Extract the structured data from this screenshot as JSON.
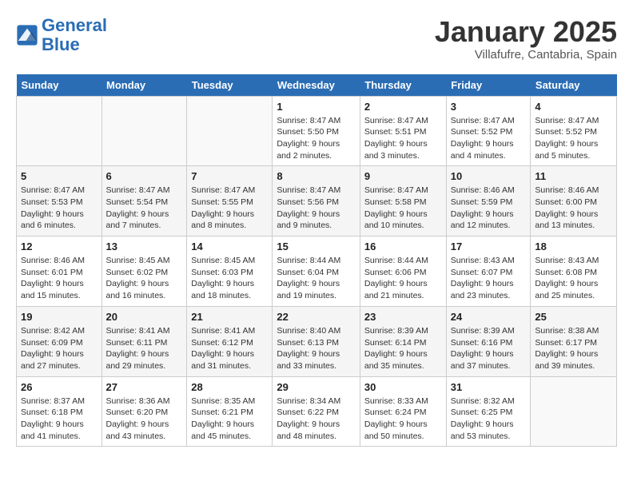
{
  "logo": {
    "line1": "General",
    "line2": "Blue"
  },
  "title": "January 2025",
  "location": "Villafufre, Cantabria, Spain",
  "days_of_week": [
    "Sunday",
    "Monday",
    "Tuesday",
    "Wednesday",
    "Thursday",
    "Friday",
    "Saturday"
  ],
  "weeks": [
    [
      {
        "day": "",
        "info": ""
      },
      {
        "day": "",
        "info": ""
      },
      {
        "day": "",
        "info": ""
      },
      {
        "day": "1",
        "info": "Sunrise: 8:47 AM\nSunset: 5:50 PM\nDaylight: 9 hours and 2 minutes."
      },
      {
        "day": "2",
        "info": "Sunrise: 8:47 AM\nSunset: 5:51 PM\nDaylight: 9 hours and 3 minutes."
      },
      {
        "day": "3",
        "info": "Sunrise: 8:47 AM\nSunset: 5:52 PM\nDaylight: 9 hours and 4 minutes."
      },
      {
        "day": "4",
        "info": "Sunrise: 8:47 AM\nSunset: 5:52 PM\nDaylight: 9 hours and 5 minutes."
      }
    ],
    [
      {
        "day": "5",
        "info": "Sunrise: 8:47 AM\nSunset: 5:53 PM\nDaylight: 9 hours and 6 minutes."
      },
      {
        "day": "6",
        "info": "Sunrise: 8:47 AM\nSunset: 5:54 PM\nDaylight: 9 hours and 7 minutes."
      },
      {
        "day": "7",
        "info": "Sunrise: 8:47 AM\nSunset: 5:55 PM\nDaylight: 9 hours and 8 minutes."
      },
      {
        "day": "8",
        "info": "Sunrise: 8:47 AM\nSunset: 5:56 PM\nDaylight: 9 hours and 9 minutes."
      },
      {
        "day": "9",
        "info": "Sunrise: 8:47 AM\nSunset: 5:58 PM\nDaylight: 9 hours and 10 minutes."
      },
      {
        "day": "10",
        "info": "Sunrise: 8:46 AM\nSunset: 5:59 PM\nDaylight: 9 hours and 12 minutes."
      },
      {
        "day": "11",
        "info": "Sunrise: 8:46 AM\nSunset: 6:00 PM\nDaylight: 9 hours and 13 minutes."
      }
    ],
    [
      {
        "day": "12",
        "info": "Sunrise: 8:46 AM\nSunset: 6:01 PM\nDaylight: 9 hours and 15 minutes."
      },
      {
        "day": "13",
        "info": "Sunrise: 8:45 AM\nSunset: 6:02 PM\nDaylight: 9 hours and 16 minutes."
      },
      {
        "day": "14",
        "info": "Sunrise: 8:45 AM\nSunset: 6:03 PM\nDaylight: 9 hours and 18 minutes."
      },
      {
        "day": "15",
        "info": "Sunrise: 8:44 AM\nSunset: 6:04 PM\nDaylight: 9 hours and 19 minutes."
      },
      {
        "day": "16",
        "info": "Sunrise: 8:44 AM\nSunset: 6:06 PM\nDaylight: 9 hours and 21 minutes."
      },
      {
        "day": "17",
        "info": "Sunrise: 8:43 AM\nSunset: 6:07 PM\nDaylight: 9 hours and 23 minutes."
      },
      {
        "day": "18",
        "info": "Sunrise: 8:43 AM\nSunset: 6:08 PM\nDaylight: 9 hours and 25 minutes."
      }
    ],
    [
      {
        "day": "19",
        "info": "Sunrise: 8:42 AM\nSunset: 6:09 PM\nDaylight: 9 hours and 27 minutes."
      },
      {
        "day": "20",
        "info": "Sunrise: 8:41 AM\nSunset: 6:11 PM\nDaylight: 9 hours and 29 minutes."
      },
      {
        "day": "21",
        "info": "Sunrise: 8:41 AM\nSunset: 6:12 PM\nDaylight: 9 hours and 31 minutes."
      },
      {
        "day": "22",
        "info": "Sunrise: 8:40 AM\nSunset: 6:13 PM\nDaylight: 9 hours and 33 minutes."
      },
      {
        "day": "23",
        "info": "Sunrise: 8:39 AM\nSunset: 6:14 PM\nDaylight: 9 hours and 35 minutes."
      },
      {
        "day": "24",
        "info": "Sunrise: 8:39 AM\nSunset: 6:16 PM\nDaylight: 9 hours and 37 minutes."
      },
      {
        "day": "25",
        "info": "Sunrise: 8:38 AM\nSunset: 6:17 PM\nDaylight: 9 hours and 39 minutes."
      }
    ],
    [
      {
        "day": "26",
        "info": "Sunrise: 8:37 AM\nSunset: 6:18 PM\nDaylight: 9 hours and 41 minutes."
      },
      {
        "day": "27",
        "info": "Sunrise: 8:36 AM\nSunset: 6:20 PM\nDaylight: 9 hours and 43 minutes."
      },
      {
        "day": "28",
        "info": "Sunrise: 8:35 AM\nSunset: 6:21 PM\nDaylight: 9 hours and 45 minutes."
      },
      {
        "day": "29",
        "info": "Sunrise: 8:34 AM\nSunset: 6:22 PM\nDaylight: 9 hours and 48 minutes."
      },
      {
        "day": "30",
        "info": "Sunrise: 8:33 AM\nSunset: 6:24 PM\nDaylight: 9 hours and 50 minutes."
      },
      {
        "day": "31",
        "info": "Sunrise: 8:32 AM\nSunset: 6:25 PM\nDaylight: 9 hours and 53 minutes."
      },
      {
        "day": "",
        "info": ""
      }
    ]
  ]
}
